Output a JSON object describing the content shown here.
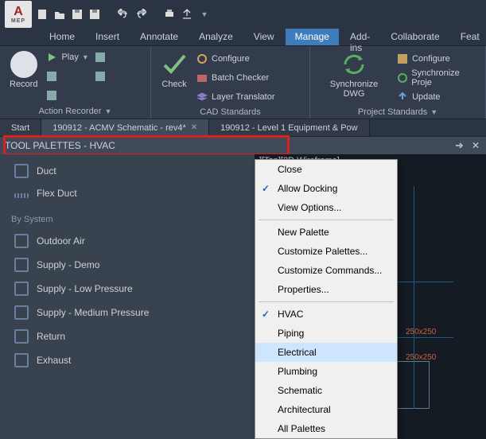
{
  "app": {
    "logo_letter": "A",
    "logo_sub": "MEP"
  },
  "qat": {
    "items": [
      "new-icon",
      "open-icon",
      "save-icon",
      "saveas-icon",
      "print-icon",
      "undo-icon",
      "redo-icon",
      "plot-icon",
      "export-icon",
      "dropdown-icon"
    ]
  },
  "ribbon_tabs": {
    "items": [
      "Home",
      "Insert",
      "Annotate",
      "Analyze",
      "View",
      "Manage",
      "Add-ins",
      "Collaborate",
      "Feat"
    ],
    "active": 5
  },
  "ribbon": {
    "action_recorder": {
      "record": "Record",
      "play": "Play",
      "panel_label": "Action Recorder"
    },
    "cad_standards": {
      "check": "Check",
      "configure": "Configure",
      "batch_checker": "Batch Checker",
      "layer_translator": "Layer Translator",
      "panel_label": "CAD Standards"
    },
    "project_standards": {
      "sync": "Synchronize DWG",
      "configure": "Configure",
      "sync_project": "Synchronize Proje",
      "update": "Update",
      "panel_label": "Project Standards"
    }
  },
  "drawing_tabs": {
    "items": [
      {
        "label": "Start",
        "closeable": false
      },
      {
        "label": "190912 - ACMV Schematic - rev4*",
        "closeable": true,
        "active": true
      },
      {
        "label": "190912 - Level 1 Equipment & Pow",
        "closeable": false
      }
    ]
  },
  "palette": {
    "title": "TOOL PALETTES - HVAC",
    "items_top": [
      {
        "label": "Duct",
        "icon": "box"
      },
      {
        "label": "Flex Duct",
        "icon": "flex"
      }
    ],
    "group_label": "By System",
    "items_system": [
      "Outdoor Air",
      "Supply - Demo",
      "Supply - Low Pressure",
      "Supply - Medium Pressure",
      "Return",
      "Exhaust"
    ]
  },
  "view_label": "][Top][2D Wireframe]",
  "context_menu": {
    "items": [
      {
        "label": "Close",
        "type": "item"
      },
      {
        "label": "Allow Docking",
        "type": "item",
        "checked": true
      },
      {
        "label": "View Options...",
        "type": "item"
      },
      {
        "type": "sep"
      },
      {
        "label": "New Palette",
        "type": "item"
      },
      {
        "label": "Customize Palettes...",
        "type": "item"
      },
      {
        "label": "Customize Commands...",
        "type": "item"
      },
      {
        "label": "Properties...",
        "type": "item"
      },
      {
        "type": "sep"
      },
      {
        "label": "HVAC",
        "type": "item",
        "checked": true
      },
      {
        "label": "Piping",
        "type": "item"
      },
      {
        "label": "Electrical",
        "type": "item",
        "highlight": true
      },
      {
        "label": "Plumbing",
        "type": "item"
      },
      {
        "label": "Schematic",
        "type": "item"
      },
      {
        "label": "Architectural",
        "type": "item"
      },
      {
        "label": "All Palettes",
        "type": "item"
      }
    ]
  },
  "cad_annotation_text": "250x250"
}
